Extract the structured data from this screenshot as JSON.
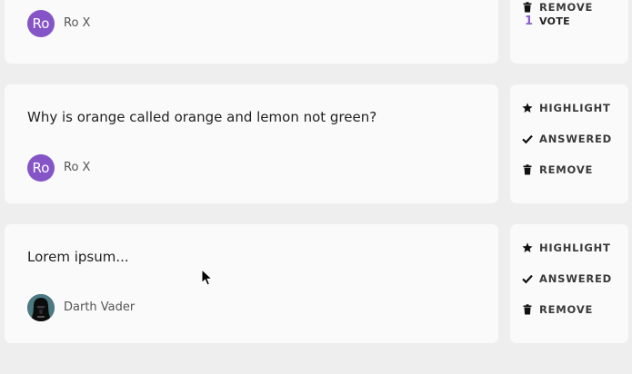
{
  "questions": [
    {
      "text": "",
      "author": "Ro X",
      "avatar_initials": "Ro",
      "actions": [
        {
          "label": "REMOVE",
          "icon": "trash-icon"
        }
      ],
      "votes": {
        "count": "1",
        "label": "VOTE"
      }
    },
    {
      "text": "Why is orange called orange and lemon not green?",
      "author": "Ro X",
      "avatar_initials": "Ro",
      "actions": [
        {
          "label": "HIGHLIGHT",
          "icon": "star-icon"
        },
        {
          "label": "ANSWERED",
          "icon": "check-icon"
        },
        {
          "label": "REMOVE",
          "icon": "trash-icon"
        }
      ]
    },
    {
      "text": "Lorem ipsum...",
      "author": "Darth Vader",
      "avatar_initials": "",
      "avatar_icon": "darth-vader-avatar",
      "actions": [
        {
          "label": "HIGHLIGHT",
          "icon": "star-icon"
        },
        {
          "label": "ANSWERED",
          "icon": "check-icon"
        },
        {
          "label": "REMOVE",
          "icon": "trash-icon"
        }
      ]
    }
  ],
  "colors": {
    "background": "#eeeeee",
    "card": "#fafafa",
    "avatar": "#8555c8",
    "vote_count": "#8a5fd0"
  }
}
